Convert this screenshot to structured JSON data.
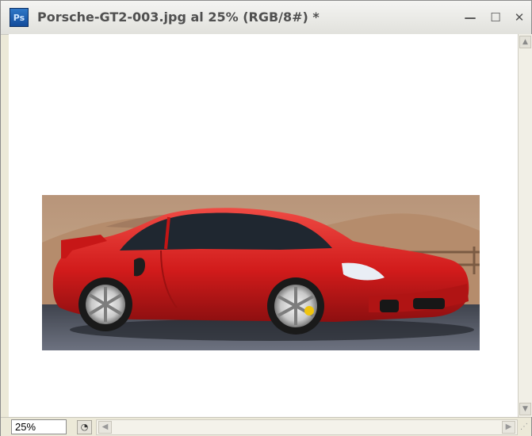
{
  "window": {
    "app_icon_label": "Ps",
    "title": "Porsche-GT2-003.jpg al 25% (RGB/8#) *",
    "controls": {
      "minimize": "—",
      "maximize": "☐",
      "close": "✕"
    }
  },
  "status": {
    "zoom": "25%"
  },
  "icons": {
    "app": "photoshop-icon",
    "minimize": "minimize-icon",
    "maximize": "maximize-icon",
    "close": "close-icon",
    "scroll_up": "chevron-up-icon",
    "scroll_down": "chevron-down-icon",
    "scroll_left": "chevron-left-icon",
    "scroll_right": "chevron-right-icon",
    "status": "document-status-icon",
    "grip": "resize-grip-icon"
  },
  "colors": {
    "car": "#d81e1e",
    "background": "#ffffff"
  }
}
